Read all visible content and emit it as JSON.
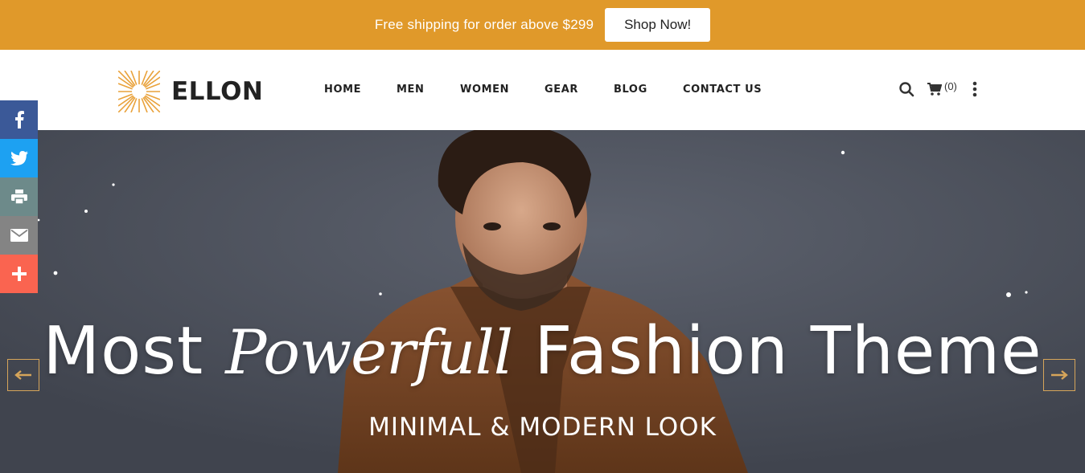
{
  "promo": {
    "text": "Free shipping for order above $299",
    "button_label": "Shop Now!",
    "background": "#e0992a"
  },
  "header": {
    "logo_text": "ELLON",
    "logo_icon": "sunburst-logo",
    "nav": [
      "HOME",
      "MEN",
      "WOMEN",
      "GEAR",
      "BLOG",
      "CONTACT US"
    ],
    "cart_count": "(0)",
    "icons": [
      "search-icon",
      "cart-icon",
      "more-vertical-icon"
    ]
  },
  "hero": {
    "title_before": "Most",
    "title_script": "Powerfull",
    "title_after": "Fashion Theme",
    "subtitle": "MINIMAL & MODERN LOOK",
    "prev_icon": "arrow-left-icon",
    "next_icon": "arrow-right-icon",
    "arrow_color": "#d6a55a"
  },
  "share": [
    {
      "name": "facebook",
      "icon": "facebook-icon",
      "color": "#3b5998"
    },
    {
      "name": "twitter",
      "icon": "twitter-icon",
      "color": "#1da1f2"
    },
    {
      "name": "print",
      "icon": "print-icon",
      "color": "#6d8a8a"
    },
    {
      "name": "email",
      "icon": "email-icon",
      "color": "#848484"
    },
    {
      "name": "more",
      "icon": "plus-icon",
      "color": "#fa6450"
    }
  ]
}
